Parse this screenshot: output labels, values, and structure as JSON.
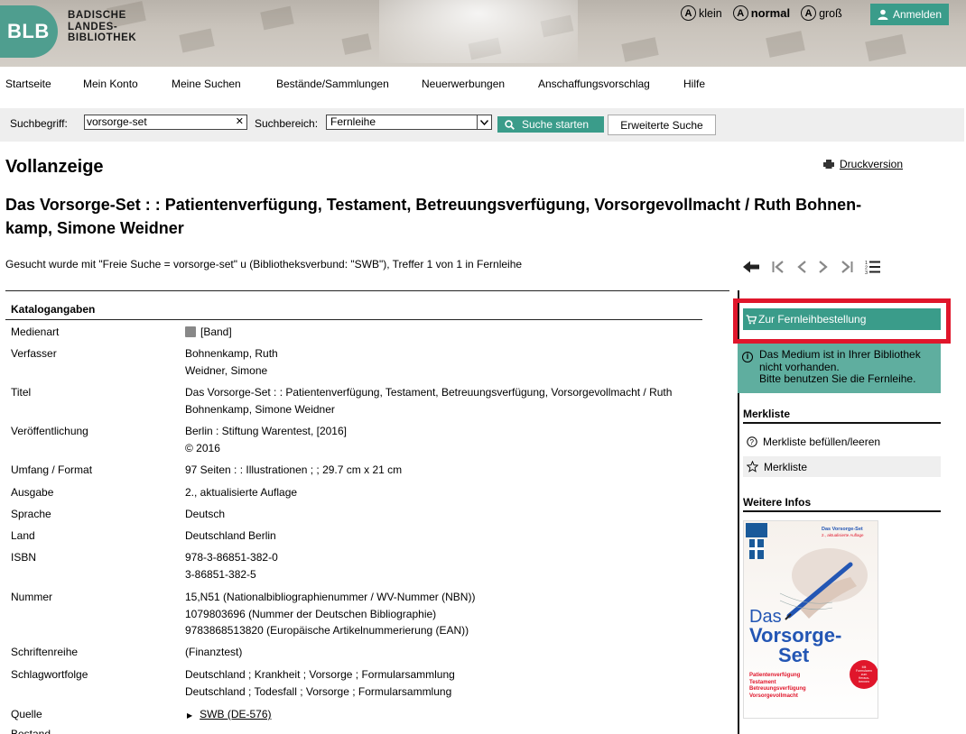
{
  "header": {
    "logo_abbr": "BLB",
    "logo_lines": [
      "BADISCHE",
      "LANDES-",
      "BIBLIOTHEK"
    ],
    "font_sizes": [
      {
        "letter": "A",
        "label": "klein"
      },
      {
        "letter": "A",
        "label": "normal"
      },
      {
        "letter": "A",
        "label": "groß"
      }
    ],
    "login_label": "Anmelden"
  },
  "nav": {
    "items": [
      "Startseite",
      "Mein Konto",
      "Meine Suchen",
      "Bestände/Sammlungen",
      "Neuerwerbungen",
      "Anschaffungsvorschlag",
      "Hilfe"
    ]
  },
  "search": {
    "term_label": "Suchbegriff:",
    "term_value": "vorsorge-set",
    "clear_glyph": "✕",
    "area_label": "Suchbereich:",
    "area_value": "Fernleihe",
    "search_button": "Suche starten",
    "advanced_button": "Erweiterte Suche"
  },
  "page": {
    "heading": "Vollanzeige",
    "print_label": "Druckversion",
    "title_line1": "Das Vorsorge-Set : : Patientenverfügung, Testament, Betreuungsverfügung, Vorsorgevollmacht / Ruth Bohnen-",
    "title_line2": "kamp, Simone Weidner",
    "search_info": "Gesucht wurde mit \"Freie Suche = vorsorge-set\" u (Bibliotheksverbund: \"SWB\"), Treffer 1 von 1 in Fernleihe"
  },
  "catalog": {
    "header": "Katalogangaben",
    "rows": [
      {
        "key": "Medienart",
        "values": [
          "[Band]"
        ]
      },
      {
        "key": "Verfasser",
        "values": [
          "Bohnenkamp, Ruth",
          "Weidner, Simone"
        ]
      },
      {
        "key": "Titel",
        "values": [
          "Das Vorsorge-Set : : Patientenverfügung, Testament, Betreuungsverfügung, Vorsorgevollmacht / Ruth",
          "Bohnenkamp, Simone Weidner"
        ]
      },
      {
        "key": "Veröffentlichung",
        "values": [
          "Berlin : Stiftung Warentest, [2016]",
          "© 2016"
        ]
      },
      {
        "key": "Umfang / Format",
        "values": [
          "97 Seiten : : Illustrationen ; ; 29.7 cm x 21 cm"
        ]
      },
      {
        "key": "Ausgabe",
        "values": [
          "2., aktualisierte Auflage"
        ]
      },
      {
        "key": "Sprache",
        "values": [
          "Deutsch"
        ]
      },
      {
        "key": "Land",
        "values": [
          "Deutschland Berlin"
        ]
      },
      {
        "key": "ISBN",
        "values": [
          "978-3-86851-382-0",
          "3-86851-382-5"
        ]
      },
      {
        "key": "Nummer",
        "values": [
          "15,N51 (Nationalbibliographienummer / WV-Nummer (NBN))",
          "1079803696 (Nummer der Deutschen Bibliographie)",
          "9783868513820 (Europäische Artikelnummerierung (EAN))"
        ]
      },
      {
        "key": "Schriftenreihe",
        "values": [
          "(Finanztest)"
        ]
      },
      {
        "key": "Schlagwortfolge",
        "values": [
          "Deutschland ; Krankheit ; Vorsorge ; Formularsammlung",
          "Deutschland ; Todesfall ; Vorsorge ; Formularsammlung"
        ]
      },
      {
        "key": "Quelle",
        "values": [
          "SWB (DE-576)"
        ]
      },
      {
        "key": "Bestand",
        "values": []
      }
    ]
  },
  "sidebar": {
    "order_button": "Zur Fernleihbestellung",
    "notice_lines": [
      "Das Medium ist in Ihrer Bibliothek",
      "nicht vorhanden.",
      "Bitte benutzen Sie die Fernleihe."
    ],
    "merkliste_heading": "Merkliste",
    "merkliste_fill": "Merkliste befüllen/leeren",
    "merkliste": "Merkliste",
    "infos_heading": "Weitere Infos",
    "cover": {
      "top_small": "Das Vorsorge-Set",
      "top_small2": "2., aktualisierte Auflage",
      "word1": "Das",
      "word2": "Vorsorge-",
      "word3": "Set",
      "badge": "Mit Formularen zum Heraus-trennen",
      "subs": [
        "Patientenverfügung",
        "Testament",
        "Betreuungsverfügung",
        "Vorsorgevollmacht"
      ]
    }
  },
  "colors": {
    "accent": "#3a9c8a",
    "notice": "#5fae9f",
    "highlight": "#e0162b"
  }
}
